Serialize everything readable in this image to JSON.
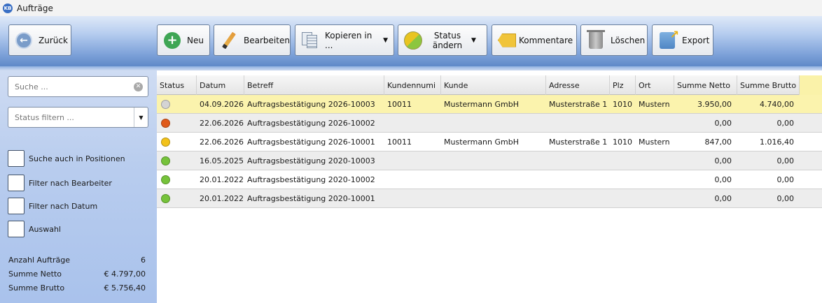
{
  "window": {
    "logo_text": "KB",
    "title": "Aufträge"
  },
  "toolbar": {
    "back": "Zurück",
    "new": "Neu",
    "edit": "Bearbeiten",
    "copy": "Kopieren in ...",
    "status_line1": "Status",
    "status_line2": "ändern",
    "comments": "Kommentare",
    "delete": "Löschen",
    "export": "Export"
  },
  "sidebar": {
    "search_placeholder": "Suche ...",
    "status_placeholder": "Status filtern ...",
    "checkboxes": [
      {
        "label": "Suche auch in Positionen",
        "checked": false
      },
      {
        "label": "Filter nach Bearbeiter",
        "checked": false
      },
      {
        "label": "Filter nach Datum",
        "checked": false
      },
      {
        "label": "Auswahl",
        "checked": false
      }
    ],
    "summary": [
      {
        "label": "Anzahl Aufträge",
        "value": "6"
      },
      {
        "label": "Summe Netto",
        "value": "€ 4.797,00"
      },
      {
        "label": "Summe Brutto",
        "value": "€ 5.756,40"
      }
    ]
  },
  "grid": {
    "columns": [
      "Status",
      "Datum",
      "Betreff",
      "Kundennumi",
      "Kunde",
      "Adresse",
      "Plz",
      "Ort",
      "Summe Netto",
      "Summe Brutto"
    ],
    "status_colors": {
      "grey": "#d4d4d4",
      "red": "#e05a1a",
      "yellow": "#f2c21a",
      "green": "#76c33a"
    },
    "rows": [
      {
        "status": "grey",
        "datum": "04.09.2026",
        "betreff": "Auftragsbestätigung 2026-10003",
        "kundennummer": "10011",
        "kunde": "Mustermann GmbH",
        "adresse": "Musterstraße 1",
        "plz": "1010",
        "ort": "Mustern",
        "netto": "3.950,00",
        "brutto": "4.740,00"
      },
      {
        "status": "red",
        "datum": "22.06.2026",
        "betreff": "Auftragsbestätigung 2026-10002",
        "kundennummer": "",
        "kunde": "",
        "adresse": "",
        "plz": "",
        "ort": "",
        "netto": "0,00",
        "brutto": "0,00"
      },
      {
        "status": "yellow",
        "datum": "22.06.2026",
        "betreff": "Auftragsbestätigung 2026-10001",
        "kundennummer": "10011",
        "kunde": "Mustermann GmbH",
        "adresse": "Musterstraße 1",
        "plz": "1010",
        "ort": "Mustern",
        "netto": "847,00",
        "brutto": "1.016,40"
      },
      {
        "status": "green",
        "datum": "16.05.2025",
        "betreff": "Auftragsbestätigung 2020-10003",
        "kundennummer": "",
        "kunde": "",
        "adresse": "",
        "plz": "",
        "ort": "",
        "netto": "0,00",
        "brutto": "0,00"
      },
      {
        "status": "green",
        "datum": "20.01.2022",
        "betreff": "Auftragsbestätigung 2020-10002",
        "kundennummer": "",
        "kunde": "",
        "adresse": "",
        "plz": "",
        "ort": "",
        "netto": "0,00",
        "brutto": "0,00"
      },
      {
        "status": "green",
        "datum": "20.01.2022",
        "betreff": "Auftragsbestätigung 2020-10001",
        "kundennummer": "",
        "kunde": "",
        "adresse": "",
        "plz": "",
        "ort": "",
        "netto": "0,00",
        "brutto": "0,00"
      }
    ]
  }
}
